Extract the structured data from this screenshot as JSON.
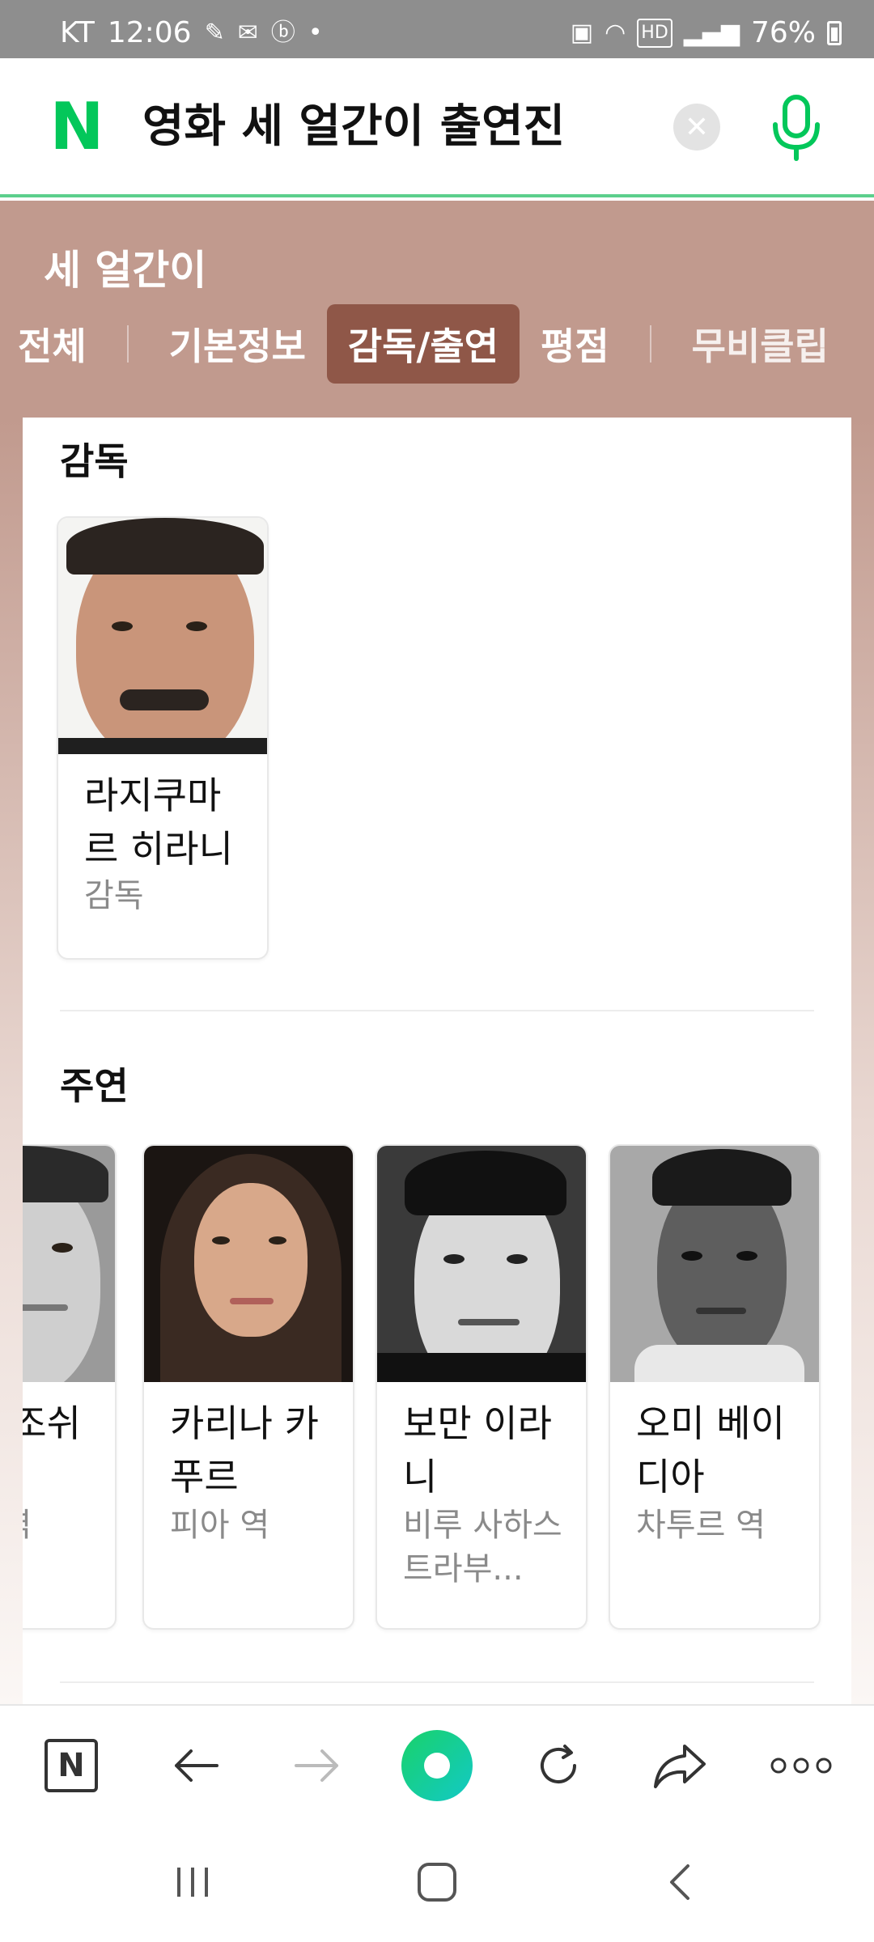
{
  "status_bar": {
    "carrier": "KT",
    "time": "12:06",
    "network": "HD",
    "battery": "76%"
  },
  "search": {
    "query": "영화 세 얼간이 출연진",
    "logo_letter": "N"
  },
  "movie": {
    "title": "세 얼간이"
  },
  "tabs": [
    {
      "label": "전체",
      "active": false
    },
    {
      "label": "기본정보",
      "active": false
    },
    {
      "label": "감독/출연",
      "active": true
    },
    {
      "label": "평점",
      "active": false
    },
    {
      "label": "무비클립",
      "active": false
    }
  ],
  "director_section": {
    "title": "감독",
    "people": [
      {
        "name": "라지쿠마르 히라니",
        "role": "감독"
      }
    ]
  },
  "lead_section": {
    "title": "주연",
    "people": [
      {
        "name": "셔먼 조쉬",
        "role": "라주 역"
      },
      {
        "name": "카리나 카푸르",
        "role": "피아 역"
      },
      {
        "name": "보만 이라니",
        "role": "비루 사하스트라부..."
      },
      {
        "name": "오미 베이디아",
        "role": "차투르 역"
      }
    ]
  },
  "browser_bar": {
    "logo_letter": "N"
  },
  "colors": {
    "naver_green": "#03c75a",
    "header_brown": "#c19a8e",
    "active_tab": "#8f5748"
  },
  "icons": [
    "naver-logo-icon",
    "clear-icon",
    "mic-icon",
    "back-icon",
    "forward-icon",
    "green-dot-icon",
    "refresh-icon",
    "share-icon",
    "more-icon",
    "recents-icon",
    "home-icon",
    "nav-back-icon"
  ]
}
